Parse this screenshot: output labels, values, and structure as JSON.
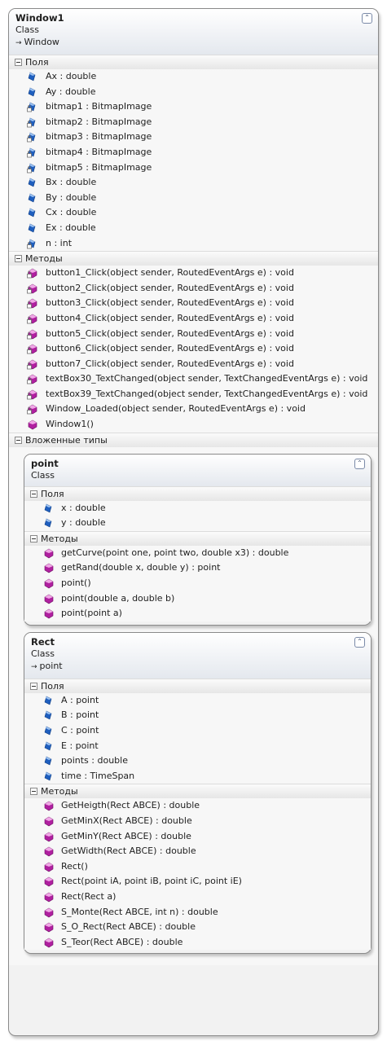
{
  "main_class": {
    "name": "Window1",
    "kind": "Class",
    "base": "Window",
    "fields_title": "Поля",
    "fields": [
      {
        "text": "Ax : double",
        "icon": "public-field-icon"
      },
      {
        "text": "Ay : double",
        "icon": "public-field-icon"
      },
      {
        "text": "bitmap1 : BitmapImage",
        "icon": "private-field-icon"
      },
      {
        "text": "bitmap2 : BitmapImage",
        "icon": "private-field-icon"
      },
      {
        "text": "bitmap3 : BitmapImage",
        "icon": "private-field-icon"
      },
      {
        "text": "bitmap4 : BitmapImage",
        "icon": "private-field-icon"
      },
      {
        "text": "bitmap5 : BitmapImage",
        "icon": "private-field-icon"
      },
      {
        "text": "Bx : double",
        "icon": "public-field-icon"
      },
      {
        "text": "By : double",
        "icon": "public-field-icon"
      },
      {
        "text": "Cx : double",
        "icon": "public-field-icon"
      },
      {
        "text": "Ex : double",
        "icon": "public-field-icon"
      },
      {
        "text": "n : int",
        "icon": "private-field-icon"
      }
    ],
    "methods_title": "Методы",
    "methods": [
      {
        "text": "button1_Click(object sender, RoutedEventArgs e) : void",
        "icon": "private-method-icon"
      },
      {
        "text": "button2_Click(object sender, RoutedEventArgs e) : void",
        "icon": "private-method-icon"
      },
      {
        "text": "button3_Click(object sender, RoutedEventArgs e) : void",
        "icon": "private-method-icon"
      },
      {
        "text": "button4_Click(object sender, RoutedEventArgs e) : void",
        "icon": "private-method-icon"
      },
      {
        "text": "button5_Click(object sender, RoutedEventArgs e) : void",
        "icon": "private-method-icon"
      },
      {
        "text": "button6_Click(object sender, RoutedEventArgs e) : void",
        "icon": "private-method-icon"
      },
      {
        "text": "button7_Click(object sender, RoutedEventArgs e) : void",
        "icon": "private-method-icon"
      },
      {
        "text": "textBox30_TextChanged(object sender, TextChangedEventArgs e) : void",
        "icon": "private-method-icon"
      },
      {
        "text": "textBox39_TextChanged(object sender, TextChangedEventArgs e) : void",
        "icon": "private-method-icon"
      },
      {
        "text": "Window_Loaded(object sender, RoutedEventArgs e) : void",
        "icon": "private-method-icon"
      },
      {
        "text": "Window1()",
        "icon": "public-method-icon"
      }
    ],
    "nested_title": "Вложенные типы"
  },
  "nested_types": [
    {
      "name": "point",
      "kind": "Class",
      "base": "",
      "fields_title": "Поля",
      "fields": [
        {
          "text": "x : double",
          "icon": "public-field-icon"
        },
        {
          "text": "y : double",
          "icon": "public-field-icon"
        }
      ],
      "methods_title": "Методы",
      "methods": [
        {
          "text": "getCurve(point one, point two, double x3) : double",
          "icon": "public-method-icon"
        },
        {
          "text": "getRand(double x, double y) : point",
          "icon": "public-method-icon"
        },
        {
          "text": "point()",
          "icon": "public-method-icon"
        },
        {
          "text": "point(double a, double b)",
          "icon": "public-method-icon"
        },
        {
          "text": "point(point a)",
          "icon": "public-method-icon"
        }
      ]
    },
    {
      "name": "Rect",
      "kind": "Class",
      "base": "point",
      "fields_title": "Поля",
      "fields": [
        {
          "text": "A : point",
          "icon": "public-field-icon"
        },
        {
          "text": "B : point",
          "icon": "public-field-icon"
        },
        {
          "text": "C : point",
          "icon": "public-field-icon"
        },
        {
          "text": "E : point",
          "icon": "public-field-icon"
        },
        {
          "text": "points : double",
          "icon": "public-field-icon"
        },
        {
          "text": "time : TimeSpan",
          "icon": "public-field-icon"
        }
      ],
      "methods_title": "Методы",
      "methods": [
        {
          "text": "GetHeigth(Rect ABCE) : double",
          "icon": "public-method-icon"
        },
        {
          "text": "GetMinX(Rect ABCE) : double",
          "icon": "public-method-icon"
        },
        {
          "text": "GetMinY(Rect ABCE) : double",
          "icon": "public-method-icon"
        },
        {
          "text": "GetWidth(Rect ABCE) : double",
          "icon": "public-method-icon"
        },
        {
          "text": "Rect()",
          "icon": "public-method-icon"
        },
        {
          "text": "Rect(point iA, point iB, point iC, point iE)",
          "icon": "public-method-icon"
        },
        {
          "text": "Rect(Rect a)",
          "icon": "public-method-icon"
        },
        {
          "text": "S_Monte(Rect ABCE, int n) : double",
          "icon": "public-method-icon"
        },
        {
          "text": "S_O_Rect(Rect ABCE) : double",
          "icon": "public-method-icon"
        },
        {
          "text": "S_Teor(Rect ABCE) : double",
          "icon": "public-method-icon"
        }
      ]
    }
  ],
  "colors": {
    "field_icon": "#1f5fbf",
    "method_icon": "#b020a0",
    "lock_icon": "#6b6b6b"
  }
}
